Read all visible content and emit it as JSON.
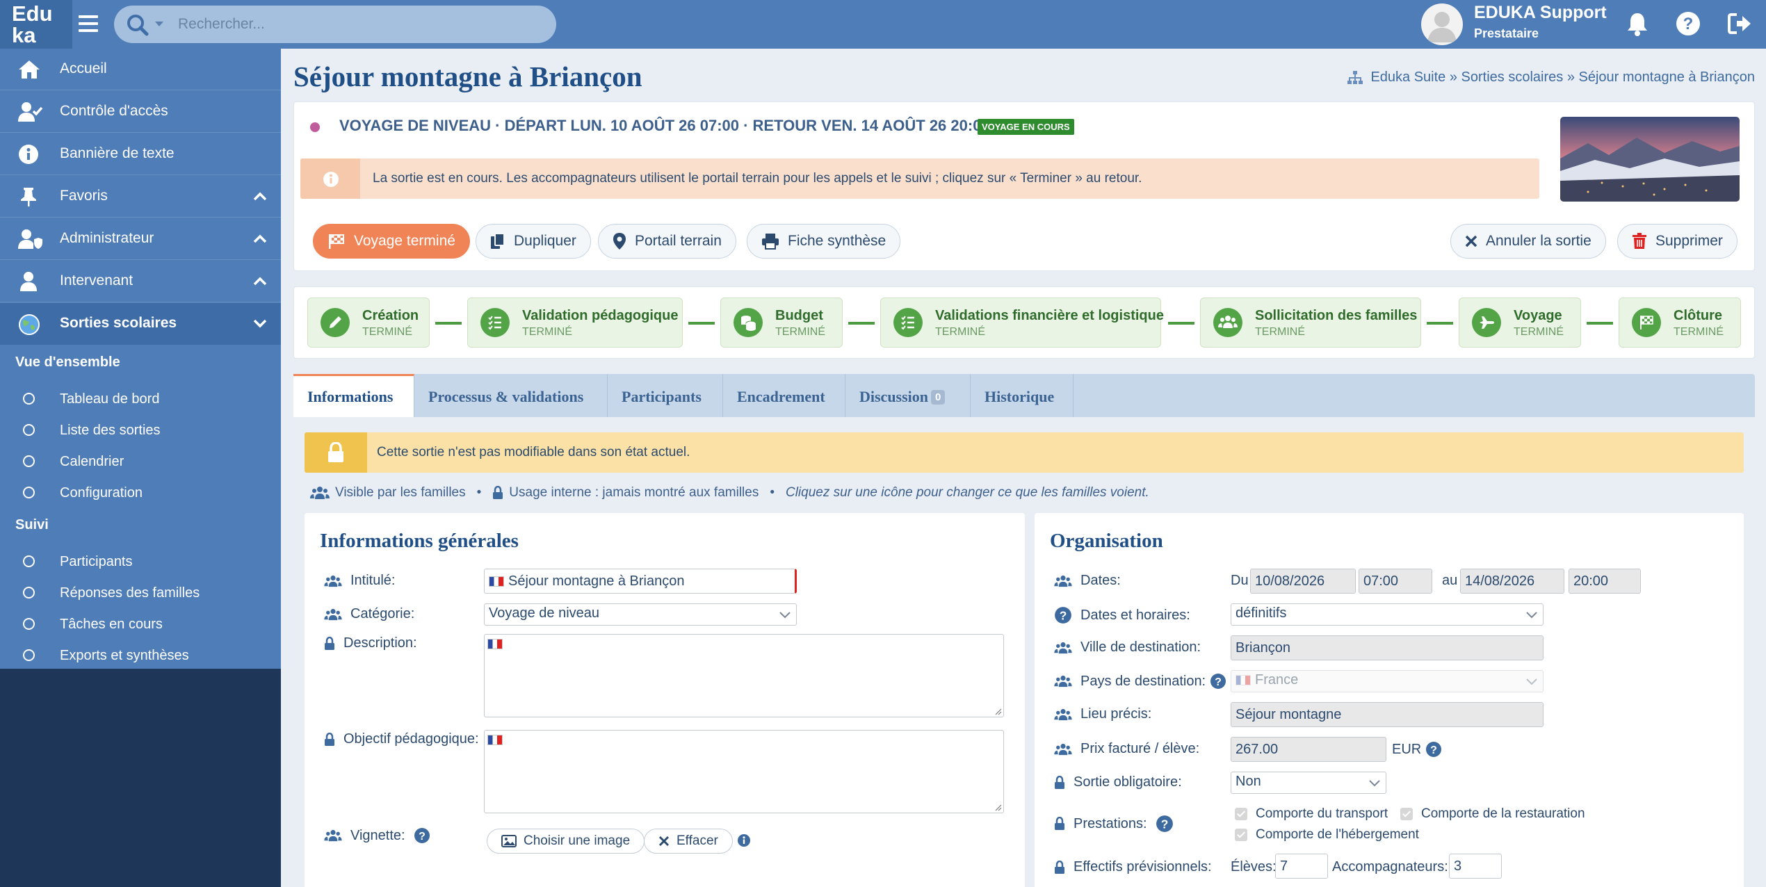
{
  "topbar": {
    "logo_line1": "Edu",
    "logo_line2": "ka",
    "search_placeholder": "Rechercher...",
    "user_name": "EDUKA Support",
    "user_role": "Prestataire"
  },
  "sidebar": {
    "items": [
      {
        "label": "Accueil",
        "icon": "home-icon"
      },
      {
        "label": "Contrôle d'accès",
        "icon": "user-check-icon"
      },
      {
        "label": "Bannière de texte",
        "icon": "info-icon"
      },
      {
        "label": "Favoris",
        "icon": "pin-icon"
      },
      {
        "label": "Administrateur",
        "icon": "user-shield-icon"
      },
      {
        "label": "Intervenant",
        "icon": "user-icon"
      },
      {
        "label": "Sorties scolaires",
        "icon": "globe-icon"
      }
    ],
    "section_overview": "Vue d'ensemble",
    "overview": [
      "Tableau de bord",
      "Liste des sorties",
      "Calendrier",
      "Configuration"
    ],
    "section_follow": "Suivi",
    "follow": [
      "Participants",
      "Réponses des familles",
      "Tâches en cours",
      "Exports et synthèses"
    ]
  },
  "page": {
    "title": "Séjour montagne à Briançon",
    "breadcrumb": "Eduka Suite » Sorties scolaires » Séjour montagne à Briançon"
  },
  "trip": {
    "header": "VOYAGE DE NIVEAU · DÉPART LUN. 10 AOÛT 26 07:00 · RETOUR VEN. 14 AOÛT 26 20:00",
    "status_badge": "VOYAGE EN COURS",
    "status_color": "#2e8b2e",
    "alert": "La sortie est en cours. Les accompagnateurs utilisent le portail terrain pour les appels et le suivi ; cliquez sur « Terminer » au retour."
  },
  "actions": {
    "finished": "Voyage terminé",
    "duplicate": "Dupliquer",
    "portal": "Portail terrain",
    "summary": "Fiche synthèse",
    "cancel": "Annuler la sortie",
    "delete": "Supprimer"
  },
  "steps": [
    {
      "name": "Création",
      "status": "TERMINÉ"
    },
    {
      "name": "Validation pédagogique",
      "status": "TERMINÉ"
    },
    {
      "name": "Budget",
      "status": "TERMINÉ"
    },
    {
      "name": "Validations financière et logistique",
      "status": "TERMINÉ"
    },
    {
      "name": "Sollicitation des familles",
      "status": "TERMINÉ"
    },
    {
      "name": "Voyage",
      "status": "TERMINÉ"
    },
    {
      "name": "Clôture",
      "status": "TERMINÉ"
    }
  ],
  "tabs": [
    {
      "label": "Informations"
    },
    {
      "label": "Processus & validations"
    },
    {
      "label": "Participants"
    },
    {
      "label": "Encadrement"
    },
    {
      "label": "Discussion",
      "count": "0"
    },
    {
      "label": "Historique"
    }
  ],
  "lock_alert": "Cette sortie n'est pas modifiable dans son état actuel.",
  "visibility": {
    "visible": "Visible par les familles",
    "internal": "Usage interne : jamais montré aux familles",
    "hint": "Cliquez sur une icône pour changer ce que les familles voient."
  },
  "general": {
    "title": "Informations générales",
    "intitule_label": "Intitulé:",
    "intitule_value": "Séjour montagne à Briançon",
    "categorie_label": "Catégorie:",
    "categorie_value": "Voyage de niveau",
    "description_label": "Description:",
    "objectif_label": "Objectif pédagogique:",
    "vignette_label": "Vignette:",
    "choose_image": "Choisir une image",
    "clear": "Effacer"
  },
  "organisation": {
    "title": "Organisation",
    "dates_label": "Dates:",
    "du": "Du",
    "date_start": "10/08/2026",
    "time_start": "07:00",
    "au": "au",
    "date_end": "14/08/2026",
    "time_end": "20:00",
    "horaires_label": "Dates et horaires:",
    "horaires_value": "définitifs",
    "ville_label": "Ville de destination:",
    "ville_value": "Briançon",
    "pays_label": "Pays de destination:",
    "pays_value": "France",
    "lieu_label": "Lieu précis:",
    "lieu_value": "Séjour montagne",
    "prix_label": "Prix facturé / élève:",
    "prix_value": "267.00",
    "currency": "EUR",
    "obligatoire_label": "Sortie obligatoire:",
    "obligatoire_value": "Non",
    "prestations_label": "Prestations:",
    "transport": "Comporte du transport",
    "restauration": "Comporte de la restauration",
    "hebergement": "Comporte de l'hébergement",
    "effectifs_label": "Effectifs prévisionnels:",
    "eleves_label": "Élèves:",
    "eleves_value": "7",
    "accomp_label": "Accompagnateurs:",
    "accomp_value": "3"
  }
}
